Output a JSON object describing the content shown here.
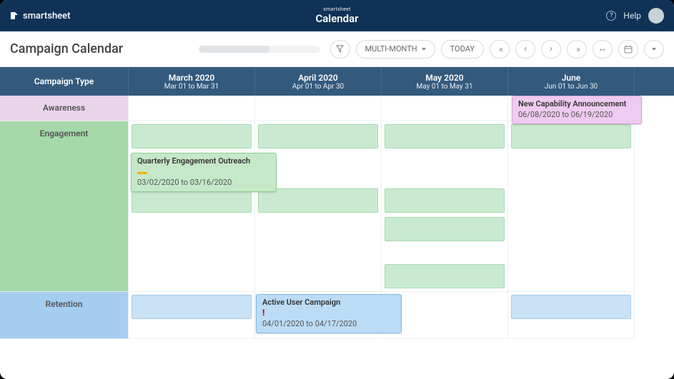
{
  "header": {
    "brand": "smartsheet",
    "app_small": "smartsheet",
    "app_name": "Calendar",
    "help_label": "Help"
  },
  "toolbar": {
    "title": "Campaign Calendar",
    "view_mode": "MULTI-MONTH",
    "today_label": "TODAY"
  },
  "columns": {
    "type_header": "Campaign Type",
    "months": [
      {
        "title": "March 2020",
        "range": "Mar 01 to Mar 31"
      },
      {
        "title": "April 2020",
        "range": "Apr 01 to Apr 30"
      },
      {
        "title": "May 2020",
        "range": "May 01 to May 31"
      },
      {
        "title": "June",
        "range": "Jun 01 to Jun 30"
      }
    ]
  },
  "rows": {
    "awareness_label": "Awareness",
    "engagement_label": "Engagement",
    "retention_label": "Retention"
  },
  "events": {
    "awareness_card": {
      "title": "New Capability Announcement",
      "dates": "06/08/2020 to 06/19/2020"
    },
    "engagement_card": {
      "title": "Quarterly Engagement Outreach",
      "dates": "03/02/2020 to 03/16/2020"
    },
    "retention_card": {
      "title": "Active User Campaign",
      "dates": "04/01/2020 to 04/17/2020"
    }
  }
}
